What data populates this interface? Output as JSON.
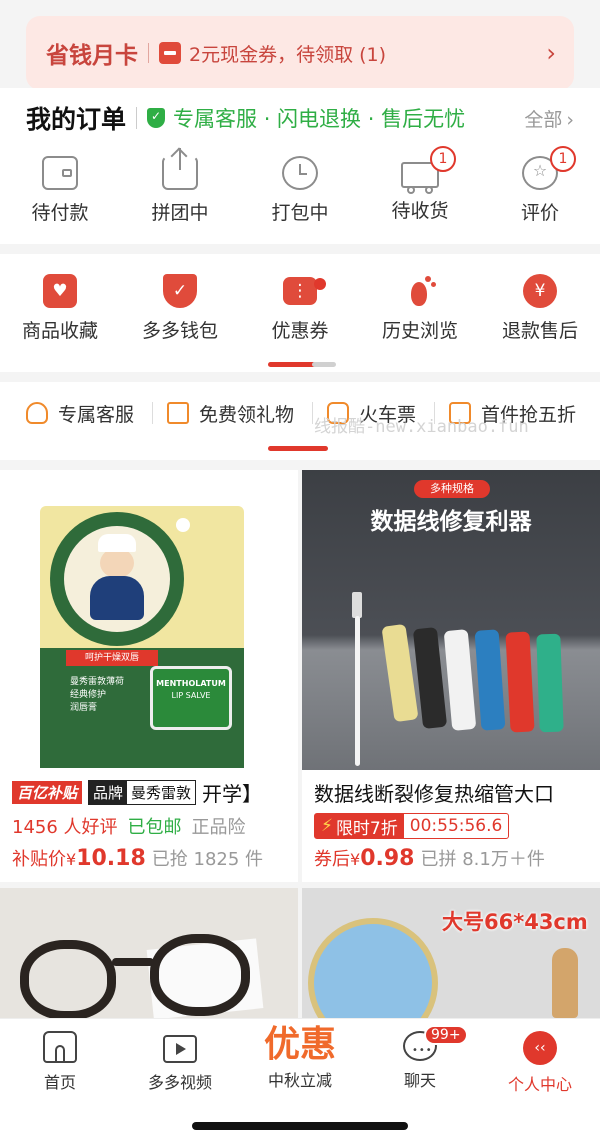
{
  "banner": {
    "title": "省钱月卡",
    "text": "2元现金券，待领取 (1)"
  },
  "orders": {
    "title": "我的订单",
    "guarantee": "专属客服 · 闪电退换 · 售后无忧",
    "all": "全部",
    "items": [
      {
        "label": "待付款",
        "icon": "wallet-icon"
      },
      {
        "label": "拼团中",
        "icon": "share-icon"
      },
      {
        "label": "打包中",
        "icon": "clock-icon"
      },
      {
        "label": "待收货",
        "icon": "truck-icon",
        "badge": "1"
      },
      {
        "label": "评价",
        "icon": "star-chat-icon",
        "badge": "1"
      }
    ]
  },
  "tools": {
    "items": [
      {
        "label": "商品收藏",
        "icon": "heart-bag-icon",
        "glyph": "♥"
      },
      {
        "label": "多多钱包",
        "icon": "wallet-check-icon",
        "glyph": "✓"
      },
      {
        "label": "优惠券",
        "icon": "coupon-icon",
        "glyph": "⋮"
      },
      {
        "label": "历史浏览",
        "icon": "footprint-icon",
        "glyph": "●"
      },
      {
        "label": "退款售后",
        "icon": "yen-icon",
        "glyph": "¥"
      }
    ]
  },
  "strip": {
    "items": [
      {
        "label": "专属客服",
        "icon": "headset-icon"
      },
      {
        "label": "免费领礼物",
        "icon": "gift-icon"
      },
      {
        "label": "火车票",
        "icon": "train-icon"
      },
      {
        "label": "首件抢五折",
        "icon": "five-icon"
      }
    ],
    "watermark": "线报酷-new.xianbao.fun"
  },
  "products": [
    {
      "tag_a": "百亿补贴",
      "brand_tag": [
        "品牌",
        "曼秀雷敦"
      ],
      "name": "开学】",
      "reviews": "1456 人好评",
      "shipping": "已包邮",
      "insurance": "正品险",
      "price_prefix": "补贴价",
      "currency": "¥",
      "price": "10.18",
      "sold": "已抢 1825 件",
      "image": {
        "label1": "曼秀雷敦薄荷",
        "label2": "经典修护",
        "label3": "润唇膏",
        "brand": "MENTHOLATUM",
        "sub": "LIP SALVE",
        "strip": "呵护干燥双唇"
      }
    },
    {
      "name": "数据线断裂修复热缩管大口",
      "flash_label": "限时7折",
      "countdown": "00:55:56.6",
      "price_prefix": "券后",
      "currency": "¥",
      "price": "0.98",
      "sold": "已拼 8.1万＋件",
      "image": {
        "badge": "多种规格",
        "headline": "数据线修复利器"
      }
    },
    {
      "image": {
        "desc": "glasses"
      }
    },
    {
      "image": {
        "size_label": "大号66*43cm"
      }
    }
  ],
  "nav": {
    "items": [
      {
        "label": "首页",
        "icon": "home-icon"
      },
      {
        "label": "多多视频",
        "icon": "tv-icon"
      },
      {
        "label": "中秋立减",
        "icon": "promo-icon",
        "big": "优惠"
      },
      {
        "label": "聊天",
        "icon": "chat-icon",
        "badge": "99+"
      },
      {
        "label": "个人中心",
        "icon": "profile-icon",
        "active": true
      }
    ]
  },
  "colors": {
    "accent": "#e0382c",
    "green": "#2fae45",
    "orange": "#f06a2b"
  }
}
